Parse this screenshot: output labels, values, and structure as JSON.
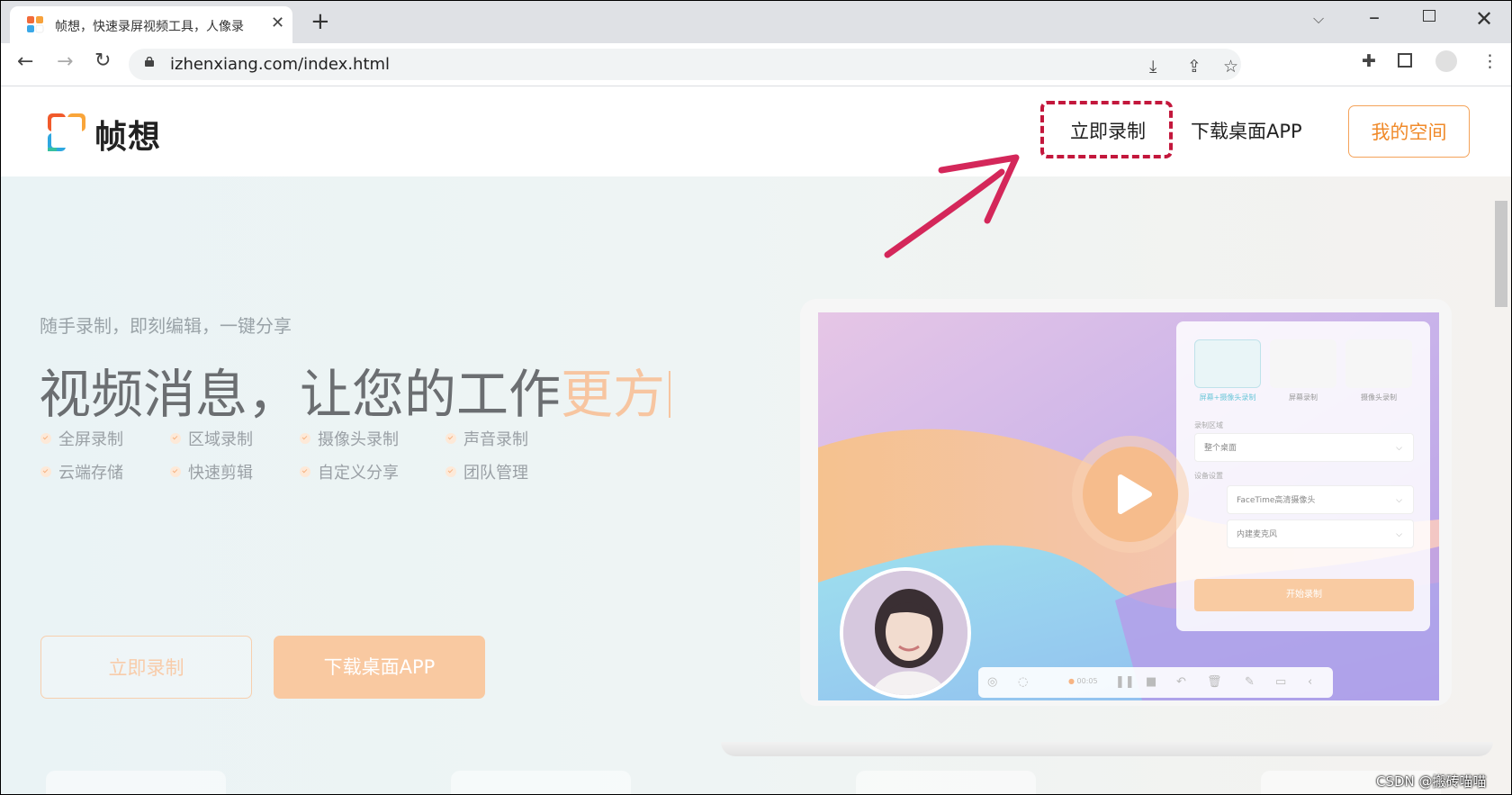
{
  "browser": {
    "tab_title": "帧想，快速录屏视频工具，人像录",
    "url": "izhenxiang.com/index.html"
  },
  "site": {
    "logo_text": "帧想",
    "nav": {
      "record": "立即录制",
      "download": "下载桌面APP",
      "my_space": "我的空间"
    },
    "hero": {
      "slogan": "随手录制，即刻编辑，一键分享",
      "headline_main": "视频消息，让您的工作",
      "headline_accent": "更方",
      "features": [
        "全屏录制",
        "区域录制",
        "摄像头录制",
        "声音录制",
        "云端存储",
        "快速剪辑",
        "自定义分享",
        "团队管理"
      ],
      "cta_record": "立即录制",
      "cta_download": "下载桌面APP"
    },
    "panel": {
      "modes": [
        "屏幕+摄像头录制",
        "屏幕录制",
        "摄像头录制"
      ],
      "area_label": "录制区域",
      "area_value": "整个桌面",
      "device_label": "设备设置",
      "camera_value": "FaceTime高清摄像头",
      "mic_value": "内建麦克风",
      "start_label": "开始录制",
      "timer": "00:05"
    }
  },
  "watermark": "CSDN @搬砖喵喵",
  "colors": {
    "accent": "#f08a2a",
    "annotation": "#c3173c"
  }
}
